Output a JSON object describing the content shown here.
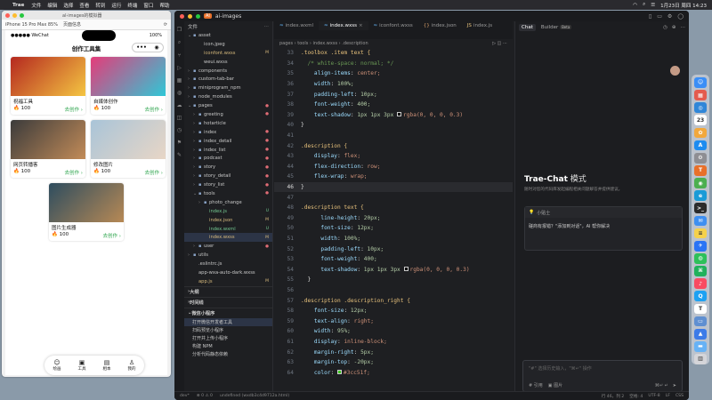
{
  "menubar": {
    "app": "Trae",
    "items": [
      "文件",
      "编辑",
      "选择",
      "查看",
      "转到",
      "运行",
      "终端",
      "窗口",
      "帮助"
    ],
    "datetime": "1月23日 周四 14:23"
  },
  "simulator": {
    "title": "al-images的模拟器",
    "device": "iPhone 15 Pro Max 85%",
    "mode": "页面信息",
    "time": "11:40",
    "carrier": "●●●●● WeChat",
    "battery": "100%",
    "nav_title": "创作工具集",
    "cards": [
      {
        "name": "祝福工具",
        "count": "100",
        "action": "去创作 ›",
        "colors": [
          "#b5281f",
          "#f4c542"
        ]
      },
      {
        "name": "自媒体创作",
        "count": "100",
        "action": "去创作 ›",
        "colors": [
          "#e53b79",
          "#2fc7d6"
        ]
      },
      {
        "name": "网页转播客",
        "count": "100",
        "action": "去创作 ›",
        "colors": [
          "#3b3b3b",
          "#c28b58"
        ]
      },
      {
        "name": "修改图片",
        "count": "100",
        "action": "去创作 ›",
        "colors": [
          "#a9c4d8",
          "#e8d6c6"
        ]
      }
    ],
    "single_card": {
      "name": "图片生成器",
      "count": "100",
      "action": "去创作 ›",
      "colors": [
        "#2e4d5f",
        "#b78955"
      ]
    },
    "tabs": [
      {
        "icon": "☺",
        "label": "绘画"
      },
      {
        "icon": "▣",
        "label": "工具"
      },
      {
        "icon": "▤",
        "label": "相本"
      },
      {
        "icon": "♙",
        "label": "我的"
      }
    ]
  },
  "ide": {
    "project": "ai-images",
    "explorer_title": "文件",
    "tree": [
      {
        "depth": 0,
        "arrow": "v",
        "icon": "▸",
        "name": "asset",
        "status": "",
        "active": false
      },
      {
        "depth": 1,
        "arrow": "",
        "icon": "▪",
        "name": "icon.jpeg",
        "status": "",
        "active": false
      },
      {
        "depth": 1,
        "arrow": "",
        "icon": "≈",
        "name": "iconfont.wxss",
        "status": "M",
        "active": false
      },
      {
        "depth": 1,
        "arrow": "",
        "icon": "≈",
        "name": "weui.wxss",
        "status": "",
        "active": false
      },
      {
        "depth": 0,
        "arrow": ">",
        "icon": "▸",
        "name": "components",
        "status": "",
        "active": false
      },
      {
        "depth": 0,
        "arrow": ">",
        "icon": "▸",
        "name": "custom-tab-bar",
        "status": "",
        "active": false
      },
      {
        "depth": 0,
        "arrow": ">",
        "icon": "▸",
        "name": "miniprogram_npm",
        "status": "",
        "active": false
      },
      {
        "depth": 0,
        "arrow": ">",
        "icon": "▸",
        "name": "node_modules",
        "status": "",
        "active": false
      },
      {
        "depth": 0,
        "arrow": "v",
        "icon": "▸",
        "name": "pages",
        "status": "●",
        "active": false
      },
      {
        "depth": 1,
        "arrow": ">",
        "icon": "▸",
        "name": "greeting",
        "status": "●",
        "active": false
      },
      {
        "depth": 1,
        "arrow": ">",
        "icon": "▸",
        "name": "hotarticle",
        "status": "",
        "active": false
      },
      {
        "depth": 1,
        "arrow": ">",
        "icon": "▸",
        "name": "index",
        "status": "●",
        "active": false
      },
      {
        "depth": 1,
        "arrow": ">",
        "icon": "▸",
        "name": "index_detail",
        "status": "●",
        "active": false
      },
      {
        "depth": 1,
        "arrow": ">",
        "icon": "▸",
        "name": "index_list",
        "status": "●",
        "active": false
      },
      {
        "depth": 1,
        "arrow": ">",
        "icon": "▸",
        "name": "podcast",
        "status": "●",
        "active": false
      },
      {
        "depth": 1,
        "arrow": ">",
        "icon": "▸",
        "name": "story",
        "status": "●",
        "active": false
      },
      {
        "depth": 1,
        "arrow": ">",
        "icon": "▸",
        "name": "story_detail",
        "status": "●",
        "active": false
      },
      {
        "depth": 1,
        "arrow": ">",
        "icon": "▸",
        "name": "story_list",
        "status": "●",
        "active": false
      },
      {
        "depth": 1,
        "arrow": "v",
        "icon": "▸",
        "name": "tools",
        "status": "●",
        "active": false
      },
      {
        "depth": 2,
        "arrow": ">",
        "icon": "▸",
        "name": "photo_change",
        "status": "",
        "active": false
      },
      {
        "depth": 2,
        "arrow": "",
        "icon": "JS",
        "name": "index.js",
        "status": "U",
        "active": false
      },
      {
        "depth": 2,
        "arrow": "",
        "icon": "{}",
        "name": "index.json",
        "status": "M",
        "active": false
      },
      {
        "depth": 2,
        "arrow": "",
        "icon": "<>",
        "name": "index.wxml",
        "status": "U",
        "active": false
      },
      {
        "depth": 2,
        "arrow": "",
        "icon": "≈",
        "name": "index.wxss",
        "status": "M",
        "active": true
      },
      {
        "depth": 1,
        "arrow": ">",
        "icon": "▸",
        "name": "user",
        "status": "●",
        "active": false
      },
      {
        "depth": 0,
        "arrow": ">",
        "icon": "▸",
        "name": "utils",
        "status": "",
        "active": false
      },
      {
        "depth": 0,
        "arrow": "",
        "icon": "◉",
        "name": ".eslintrc.js",
        "status": "",
        "active": false
      },
      {
        "depth": 0,
        "arrow": "",
        "icon": "≈",
        "name": "app-wxa-auto-dark.wxss",
        "status": "",
        "active": false
      },
      {
        "depth": 0,
        "arrow": "",
        "icon": "JS",
        "name": "app.js",
        "status": "M",
        "active": false
      }
    ],
    "sections": [
      "大纲",
      "时间线",
      "微信小程序"
    ],
    "wx_items": [
      "打开微信开发者工具",
      "扫码预览小程序",
      "打开并上传小程序",
      "构建 NPM",
      "分析代码静态依赖"
    ],
    "tabs": [
      {
        "label": "index.wxml",
        "active": false
      },
      {
        "label": "index.wxss",
        "active": true
      },
      {
        "label": "iconfont.wxss",
        "active": false
      },
      {
        "label": "index.json",
        "active": false
      },
      {
        "label": "index.js",
        "active": false
      }
    ],
    "breadcrumb": "pages › tools › index.wxss › .description",
    "active_line": "46",
    "code": [
      {
        "n": "33",
        "t": ".toolbox .item text {",
        "k": "sel"
      },
      {
        "n": "34",
        "t": "  /* white-space: normal; */",
        "k": "com"
      },
      {
        "n": "35",
        "t": "    align-items: center;",
        "k": "decl"
      },
      {
        "n": "36",
        "t": "    width: 100%;",
        "k": "decl"
      },
      {
        "n": "37",
        "t": "    padding-left: 10px;",
        "k": "decl"
      },
      {
        "n": "38",
        "t": "    font-weight: 400;",
        "k": "decl"
      },
      {
        "n": "39",
        "t": "    text-shadow: 1px 1px 3px □rgba(0, 0, 0, 0.3)",
        "k": "decl"
      },
      {
        "n": "40",
        "t": "}",
        "k": "pun"
      },
      {
        "n": "41",
        "t": "",
        "k": "pun"
      },
      {
        "n": "42",
        "t": ".description {",
        "k": "sel"
      },
      {
        "n": "43",
        "t": "    display: flex;",
        "k": "decl"
      },
      {
        "n": "44",
        "t": "    flex-direction: row;",
        "k": "decl"
      },
      {
        "n": "45",
        "t": "    flex-wrap: wrap;",
        "k": "decl"
      },
      {
        "n": "46",
        "t": "}",
        "k": "pun"
      },
      {
        "n": "47",
        "t": "",
        "k": "pun"
      },
      {
        "n": "48",
        "t": ".description text {",
        "k": "sel"
      },
      {
        "n": "49",
        "t": "      line-height: 20px;",
        "k": "decl"
      },
      {
        "n": "50",
        "t": "      font-size: 12px;",
        "k": "decl"
      },
      {
        "n": "51",
        "t": "      width: 100%;",
        "k": "decl"
      },
      {
        "n": "52",
        "t": "      padding-left: 10px;",
        "k": "decl"
      },
      {
        "n": "53",
        "t": "      font-weight: 400;",
        "k": "decl"
      },
      {
        "n": "54",
        "t": "      text-shadow: 1px 1px 3px □rgba(0, 0, 0, 0.3)",
        "k": "decl"
      },
      {
        "n": "55",
        "t": "  }",
        "k": "pun"
      },
      {
        "n": "56",
        "t": "",
        "k": "pun"
      },
      {
        "n": "57",
        "t": ".description .description_right {",
        "k": "sel"
      },
      {
        "n": "58",
        "t": "    font-size: 12px;",
        "k": "decl"
      },
      {
        "n": "59",
        "t": "    text-align: right;",
        "k": "decl"
      },
      {
        "n": "60",
        "t": "    width: 95%;",
        "k": "decl"
      },
      {
        "n": "61",
        "t": "    display: inline-block;",
        "k": "decl"
      },
      {
        "n": "62",
        "t": "    margin-right: 5px;",
        "k": "decl"
      },
      {
        "n": "63",
        "t": "    margin-top: -20px;",
        "k": "decl"
      },
      {
        "n": "64",
        "t": "    color: ■#3cc51f;",
        "k": "decl"
      }
    ],
    "chat": {
      "tab_chat": "Chat",
      "tab_builder": "Builder",
      "beta": "Beta",
      "title": "Trae-Chat",
      "title_suffix": " 模式",
      "subtitle": "随时对您的代码库发起编程相关问题解答并提供建议。",
      "tip_head": "小贴士",
      "tip_body": "磋商有报错？\"添加到对话\"，AI 帮你解决",
      "input_placeholder": "\"#\" 选择历史输入，\"⌘↵\" 操作",
      "ref": "# 引用",
      "image": "▣ 图片",
      "send_hint": "⌘↵ ↵"
    },
    "status": {
      "branch": "dev*",
      "errors": "⊗ 0 ⚠ 0",
      "path": "undefined (wxdb3c4d9712a.html)",
      "right": [
        "行 46，列 2",
        "空格: 4",
        "UTF-8",
        "LF",
        "CSS"
      ]
    }
  },
  "dock": {
    "icons": [
      {
        "name": "finder-icon",
        "color": "#3a8ef6",
        "glyph": "☺"
      },
      {
        "name": "launchpad-icon",
        "color": "#e45b4e",
        "glyph": "▦"
      },
      {
        "name": "safari-icon",
        "color": "#2f86d8",
        "glyph": "◎"
      },
      {
        "name": "calendar-icon",
        "color": "#ffffff",
        "glyph": "23"
      },
      {
        "name": "photos-icon",
        "color": "#f2a83b",
        "glyph": "✿"
      },
      {
        "name": "appstore-icon",
        "color": "#1d8cf0",
        "glyph": "A"
      },
      {
        "name": "settings-icon",
        "color": "#8e8e93",
        "glyph": "⚙"
      },
      {
        "name": "trae-icon",
        "color": "#e8702a",
        "glyph": "T"
      },
      {
        "name": "chrome-icon",
        "color": "#4caf50",
        "glyph": "◉"
      },
      {
        "name": "edge-icon",
        "color": "#1a9bd7",
        "glyph": "e"
      },
      {
        "name": "terminal-icon",
        "color": "#2b2b2b",
        "glyph": ">_"
      },
      {
        "name": "mail-icon",
        "color": "#3e8ff1",
        "glyph": "✉"
      },
      {
        "name": "notes-icon",
        "color": "#f5d14a",
        "glyph": "≡"
      },
      {
        "name": "feishu-icon",
        "color": "#2a74f5",
        "glyph": "✈"
      },
      {
        "name": "wechat-icon",
        "color": "#2dc05a",
        "glyph": "◍"
      },
      {
        "name": "wechat-devtools-icon",
        "color": "#20b15b",
        "glyph": "⌘"
      },
      {
        "name": "music-icon",
        "color": "#f94b61",
        "glyph": "♪"
      },
      {
        "name": "qq-icon",
        "color": "#1ea1f2",
        "glyph": "Q"
      },
      {
        "name": "typora-icon",
        "color": "#ffffff",
        "glyph": "T"
      },
      {
        "name": "preview-icon",
        "color": "#5f8fd1",
        "glyph": "▭"
      },
      {
        "name": "keynote-icon",
        "color": "#3c7be8",
        "glyph": "▲"
      },
      {
        "name": "folder-icon",
        "color": "#67b2f5",
        "glyph": "▬"
      },
      {
        "name": "trash-icon",
        "color": "#d5d5d9",
        "glyph": "▥"
      }
    ]
  }
}
